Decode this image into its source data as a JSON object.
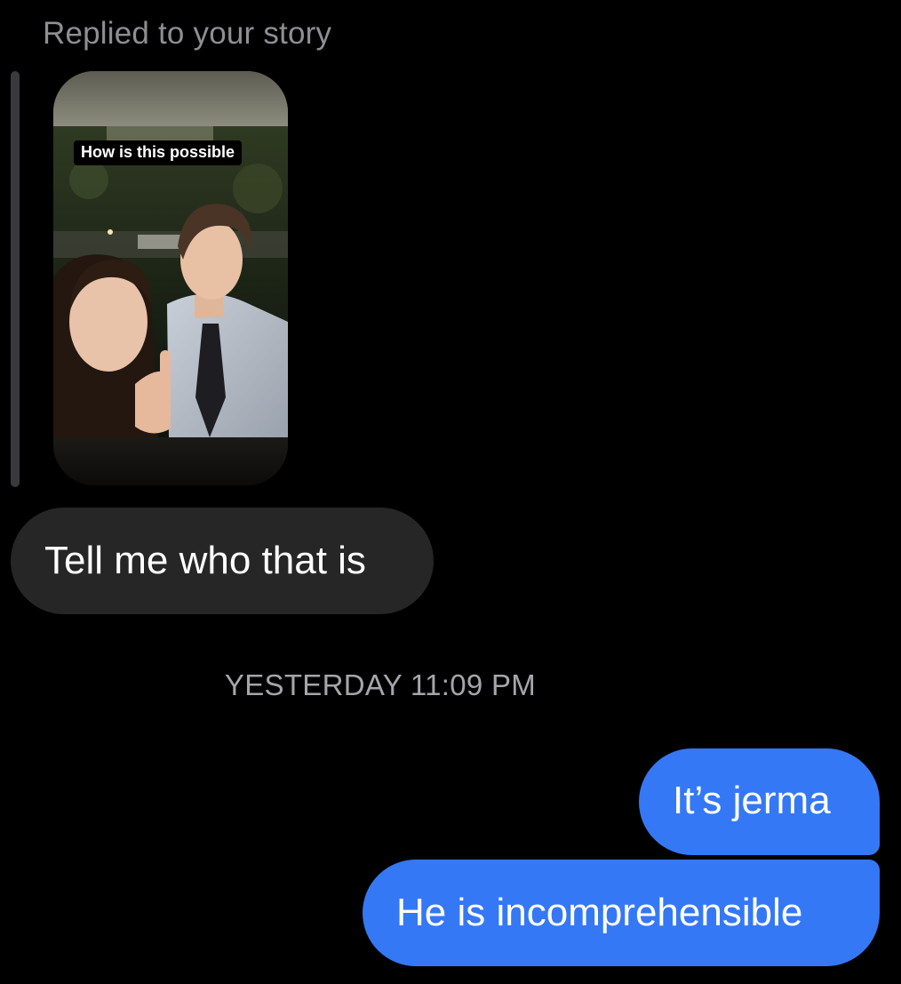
{
  "story_reply": {
    "caption": "Replied to your story",
    "sticker_text": "How is this possible"
  },
  "messages": [
    {
      "direction": "received",
      "text": "Tell me who that is"
    },
    {
      "direction": "sent",
      "text": "It’s jerma"
    },
    {
      "direction": "sent",
      "text": "He is incomprehensible"
    }
  ],
  "timestamp": "YESTERDAY 11:09 PM",
  "colors": {
    "background": "#000000",
    "received_bubble": "#262626",
    "sent_bubble": "#3478f6",
    "secondary_text": "#8e8e93"
  }
}
